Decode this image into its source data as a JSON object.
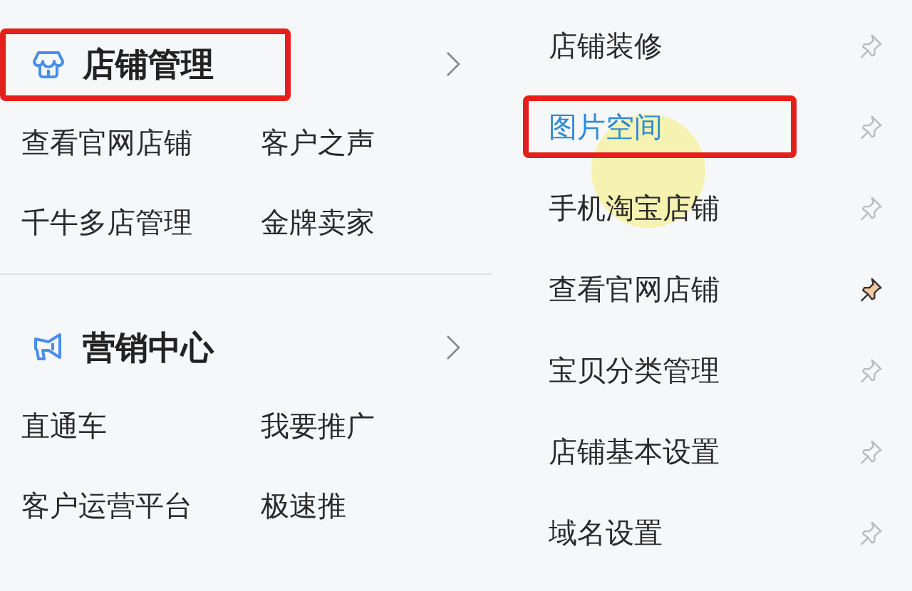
{
  "sections": [
    {
      "title": "店铺管理",
      "kind": "store",
      "annotated": true,
      "links": [
        "查看官网店铺",
        "客户之声",
        "千牛多店管理",
        "金牌卖家"
      ]
    },
    {
      "title": "营销中心",
      "kind": "marketing",
      "annotated": false,
      "links": [
        "直通车",
        "我要推广",
        "客户运营平台",
        "极速推"
      ]
    }
  ],
  "submenu": [
    {
      "label": "店铺装修",
      "selected": false,
      "pinned": false,
      "annotated": false
    },
    {
      "label": "图片空间",
      "selected": true,
      "pinned": false,
      "annotated": true
    },
    {
      "label": "手机淘宝店铺",
      "selected": false,
      "pinned": false,
      "annotated": false
    },
    {
      "label": "查看官网店铺",
      "selected": false,
      "pinned": true,
      "annotated": false
    },
    {
      "label": "宝贝分类管理",
      "selected": false,
      "pinned": false,
      "annotated": false
    },
    {
      "label": "店铺基本设置",
      "selected": false,
      "pinned": false,
      "annotated": false
    },
    {
      "label": "域名设置",
      "selected": false,
      "pinned": false,
      "annotated": false
    }
  ],
  "cursor_highlight": true
}
